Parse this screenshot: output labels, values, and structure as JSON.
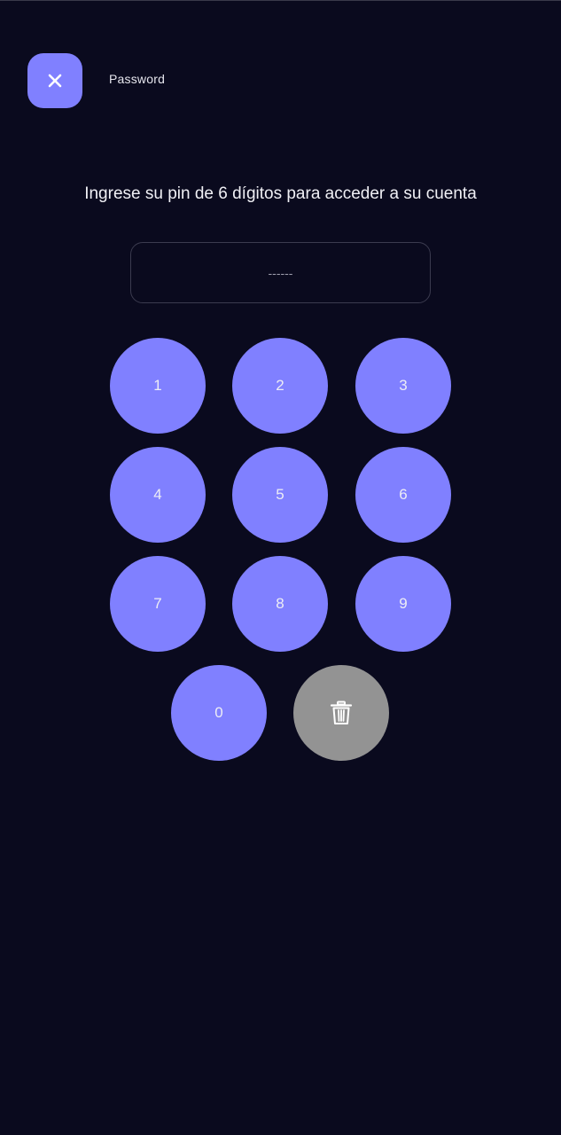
{
  "colors": {
    "background": "#0a0a1e",
    "accent": "#8080ff",
    "delete_key": "#939393",
    "text": "#ededf5"
  },
  "header": {
    "close_icon": "close-icon",
    "title": "Password"
  },
  "instruction": "Ingrese su pin de 6 dígitos para acceder a su cuenta",
  "pin": {
    "value": "",
    "placeholder": "------"
  },
  "keypad": {
    "keys": [
      "1",
      "2",
      "3",
      "4",
      "5",
      "6",
      "7",
      "8",
      "9",
      "0"
    ],
    "delete_icon": "trash-icon"
  }
}
